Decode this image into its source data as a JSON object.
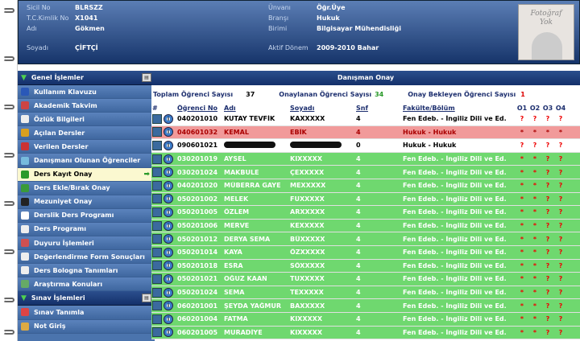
{
  "header": {
    "fields_left": [
      {
        "label": "Sicil No",
        "value": "BLRSZZ"
      },
      {
        "label": "T.C.Kimlik No",
        "value": "X1041"
      },
      {
        "label": "Adı",
        "value": "Gökmen"
      },
      {
        "label": "Soyadı",
        "value": "ÇİFTÇİ"
      }
    ],
    "fields_right": [
      {
        "label": "Ünvanı",
        "value": "Öğr.Üye"
      },
      {
        "label": "Branşı",
        "value": "Hukuk"
      },
      {
        "label": "Birimi",
        "value": "Bilgisayar Mühendisliği"
      },
      {
        "label": "Aktif Dönem",
        "value": "2009-2010 Bahar"
      }
    ],
    "photo_text_1": "Fotoğraf",
    "photo_text_2": "Yok"
  },
  "sidebar": {
    "section1": "Genel İşlemler",
    "items": [
      {
        "label": "Kullanım Klavuzu",
        "color": "#2a58b8"
      },
      {
        "label": "Akademik Takvim",
        "color": "#c44"
      },
      {
        "label": "Özlük Bilgileri",
        "color": "#eee"
      },
      {
        "label": "Açılan Dersler",
        "color": "#d9a020"
      },
      {
        "label": "Verilen Dersler",
        "color": "#c33"
      },
      {
        "label": "Danışmanı Olunan Öğrenciler",
        "color": "#7bd"
      },
      {
        "label": "Ders Kayıt Onay",
        "color": "#2a9a2a"
      },
      {
        "label": "Ders Ekle/Bırak Onay",
        "color": "#3a9a3a"
      },
      {
        "label": "Mezuniyet Onay",
        "color": "#222"
      },
      {
        "label": "Derslik Ders Programı",
        "color": "#fff"
      },
      {
        "label": "Ders Programı",
        "color": "#eee"
      },
      {
        "label": "Duyuru İşlemleri",
        "color": "#d05050"
      },
      {
        "label": "Değerlendirme Form Sonuçları",
        "color": "#eee"
      },
      {
        "label": "Ders Bologna Tanımları",
        "color": "#eee"
      },
      {
        "label": "Araştırma Konuları",
        "color": "#6a6"
      }
    ],
    "section2": "Sınav İşlemleri",
    "items2": [
      {
        "label": "Sınav Tanımla",
        "color": "#d44"
      },
      {
        "label": "Not Giriş",
        "color": "#da4"
      }
    ]
  },
  "main": {
    "title": "Danışman Onay",
    "total_label": "Toplam Öğrenci Sayısı",
    "total_value": "37",
    "approved_label": "Onaylanan Öğrenci Sayısı",
    "approved_value": "34",
    "waiting_label": "Onay Bekleyen Öğrenci Sayısı",
    "waiting_value": "1",
    "columns": [
      "#",
      "Öğrenci No",
      "Adı",
      "Soyadı",
      "Snf",
      "Fakülte/Bölüm",
      "O1",
      "O2",
      "O3",
      "O4"
    ],
    "rows": [
      {
        "no": "040201010",
        "ad": "KUTAY TEVFİK",
        "soyad": "KAXXXXX",
        "snf": "4",
        "fak": "Fen Edeb. - İngiliz Dili ve Ed.",
        "o": [
          "?",
          "?",
          "?",
          "?"
        ],
        "style": "white"
      },
      {
        "no": "040601032",
        "ad": "KEMAL",
        "soyad": "EBİK",
        "snf": "4",
        "fak": "Hukuk - Hukuk",
        "o": [
          "*",
          "*",
          "*",
          "*"
        ],
        "style": "red"
      },
      {
        "no": "090601021",
        "ad": "",
        "soyad": "",
        "snf": "0",
        "fak": "Hukuk - Hukuk",
        "o": [
          "?",
          "?",
          "?",
          "?"
        ],
        "style": "white",
        "masked": true
      },
      {
        "no": "030201019",
        "ad": "AYSEL",
        "soyad": "KIXXXXX",
        "snf": "4",
        "fak": "Fen Edeb. - İngiliz Dili ve Ed.",
        "o": [
          "*",
          "*",
          "?",
          "?"
        ],
        "style": "green"
      },
      {
        "no": "030201024",
        "ad": "MAKBULE",
        "soyad": "ÇEXXXXX",
        "snf": "4",
        "fak": "Fen Edeb. - İngiliz Dili ve Ed.",
        "o": [
          "*",
          "*",
          "?",
          "?"
        ],
        "style": "green"
      },
      {
        "no": "040201020",
        "ad": "MÜBERRA GAYE",
        "soyad": "MEXXXXX",
        "snf": "4",
        "fak": "Fen Edeb. - İngiliz Dili ve Ed.",
        "o": [
          "*",
          "*",
          "?",
          "?"
        ],
        "style": "green"
      },
      {
        "no": "050201002",
        "ad": "MELEK",
        "soyad": "FUXXXXX",
        "snf": "4",
        "fak": "Fen Edeb. - İngiliz Dili ve Ed.",
        "o": [
          "*",
          "*",
          "?",
          "?"
        ],
        "style": "green"
      },
      {
        "no": "050201005",
        "ad": "ÖZLEM",
        "soyad": "ARXXXXX",
        "snf": "4",
        "fak": "Fen Edeb. - İngiliz Dili ve Ed.",
        "o": [
          "*",
          "*",
          "?",
          "?"
        ],
        "style": "green"
      },
      {
        "no": "050201006",
        "ad": "MERVE",
        "soyad": "KEXXXXX",
        "snf": "4",
        "fak": "Fen Edeb. - İngiliz Dili ve Ed.",
        "o": [
          "*",
          "*",
          "?",
          "?"
        ],
        "style": "green"
      },
      {
        "no": "050201012",
        "ad": "DERYA SEMA",
        "soyad": "BÜXXXXX",
        "snf": "4",
        "fak": "Fen Edeb. - İngiliz Dili ve Ed.",
        "o": [
          "*",
          "*",
          "?",
          "?"
        ],
        "style": "green"
      },
      {
        "no": "050201014",
        "ad": "KAYA",
        "soyad": "ÖZXXXXX",
        "snf": "4",
        "fak": "Fen Edeb. - İngiliz Dili ve Ed.",
        "o": [
          "*",
          "*",
          "?",
          "?"
        ],
        "style": "green"
      },
      {
        "no": "050201018",
        "ad": "ESRA",
        "soyad": "SÖXXXXX",
        "snf": "4",
        "fak": "Fen Edeb. - İngiliz Dili ve Ed.",
        "o": [
          "*",
          "*",
          "?",
          "?"
        ],
        "style": "green"
      },
      {
        "no": "050201021",
        "ad": "OĞUZ KAAN",
        "soyad": "TUXXXXX",
        "snf": "4",
        "fak": "Fen Edeb. - İngiliz Dili ve Ed.",
        "o": [
          "*",
          "*",
          "?",
          "?"
        ],
        "style": "green"
      },
      {
        "no": "050201024",
        "ad": "SEMA",
        "soyad": "TEXXXXX",
        "snf": "4",
        "fak": "Fen Edeb. - İngiliz Dili ve Ed.",
        "o": [
          "*",
          "*",
          "?",
          "?"
        ],
        "style": "green"
      },
      {
        "no": "060201001",
        "ad": "ŞEYDA YAĞMUR",
        "soyad": "BAXXXXX",
        "snf": "4",
        "fak": "Fen Edeb. - İngiliz Dili ve Ed.",
        "o": [
          "*",
          "*",
          "?",
          "?"
        ],
        "style": "green"
      },
      {
        "no": "060201004",
        "ad": "FATMA",
        "soyad": "KIXXXXX",
        "snf": "4",
        "fak": "Fen Edeb. - İngiliz Dili ve Ed.",
        "o": [
          "*",
          "*",
          "?",
          "?"
        ],
        "style": "green"
      },
      {
        "no": "060201005",
        "ad": "MURADİYE",
        "soyad": "KIXXXXX",
        "snf": "4",
        "fak": "Fen Edeb. - İngiliz Dili ve Ed.",
        "o": [
          "*",
          "*",
          "?",
          "?"
        ],
        "style": "green"
      }
    ]
  }
}
